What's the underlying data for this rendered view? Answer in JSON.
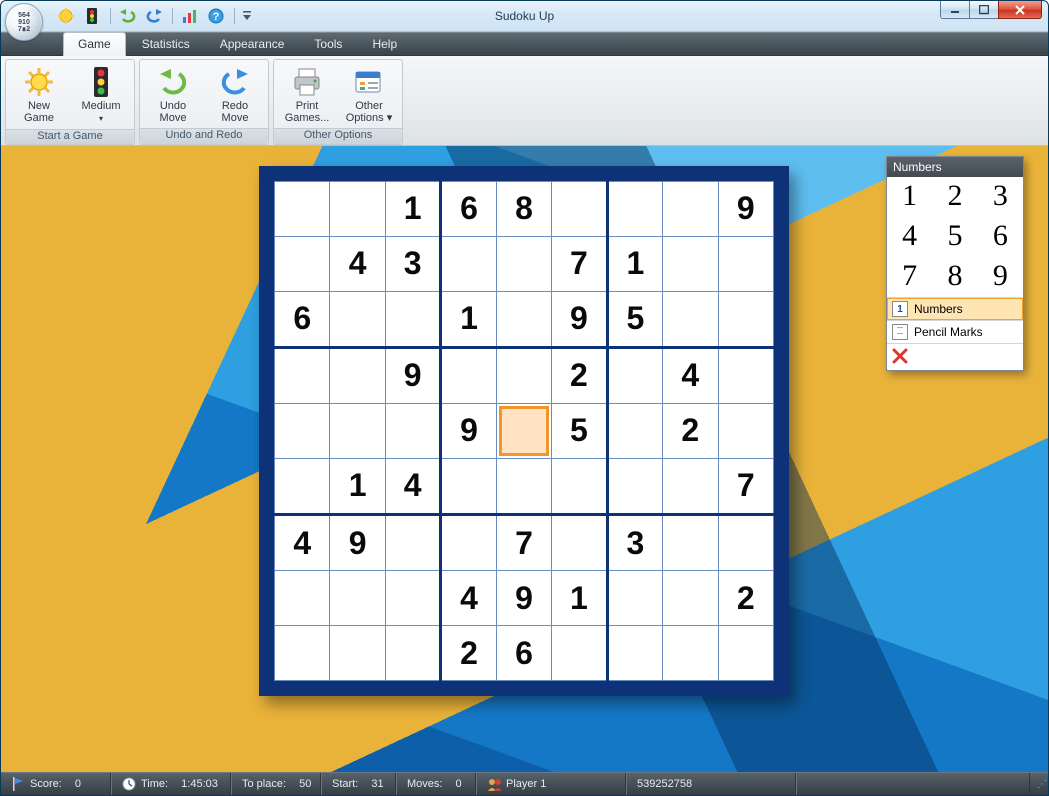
{
  "window": {
    "title": "Sudoku Up"
  },
  "qat": {
    "items": [
      "new-game",
      "difficulty",
      "sep",
      "undo",
      "redo",
      "sep",
      "stats",
      "help",
      "sep",
      "more"
    ]
  },
  "tabs": [
    "Game",
    "Statistics",
    "Appearance",
    "Tools",
    "Help"
  ],
  "active_tab": 0,
  "ribbon": {
    "groups": [
      {
        "label": "Start a Game",
        "buttons": [
          {
            "id": "new-game",
            "line1": "New",
            "line2": "Game"
          },
          {
            "id": "difficulty",
            "line1": "Medium",
            "line2": "▾"
          }
        ]
      },
      {
        "label": "Undo and Redo",
        "buttons": [
          {
            "id": "undo",
            "line1": "Undo",
            "line2": "Move"
          },
          {
            "id": "redo",
            "line1": "Redo",
            "line2": "Move"
          }
        ]
      },
      {
        "label": "Other Options",
        "buttons": [
          {
            "id": "print",
            "line1": "Print",
            "line2": "Games..."
          },
          {
            "id": "options",
            "line1": "Other",
            "line2": "Options ▾"
          }
        ]
      }
    ]
  },
  "board": {
    "selected": [
      4,
      4
    ],
    "cells": [
      [
        "",
        "",
        "1",
        "6",
        "8",
        "",
        "",
        "",
        "9"
      ],
      [
        "",
        "4",
        "3",
        "",
        "",
        "7",
        "1",
        "",
        ""
      ],
      [
        "6",
        "",
        "",
        "1",
        "",
        "9",
        "5",
        "",
        ""
      ],
      [
        "",
        "",
        "9",
        "",
        "",
        "2",
        "",
        "4",
        ""
      ],
      [
        "",
        "",
        "",
        "9",
        "",
        "5",
        "",
        "2",
        ""
      ],
      [
        "",
        "1",
        "4",
        "",
        "",
        "",
        "",
        "",
        "7"
      ],
      [
        "4",
        "9",
        "",
        "",
        "7",
        "",
        "3",
        "",
        ""
      ],
      [
        "",
        "",
        "",
        "4",
        "9",
        "1",
        "",
        "",
        "2"
      ],
      [
        "",
        "",
        "",
        "2",
        "6",
        "",
        "",
        "",
        ""
      ]
    ]
  },
  "numbers_panel": {
    "title": "Numbers",
    "digits": [
      "1",
      "2",
      "3",
      "4",
      "5",
      "6",
      "7",
      "8",
      "9"
    ],
    "mode_numbers": "Numbers",
    "mode_pencil": "Pencil Marks",
    "selected_mode": "numbers"
  },
  "status": {
    "score_label": "Score:",
    "score_value": "0",
    "time_label": "Time:",
    "time_value": "1:45:03",
    "toplace_label": "To place:",
    "toplace_value": "50",
    "start_label": "Start:",
    "start_value": "31",
    "moves_label": "Moves:",
    "moves_value": "0",
    "player_label": "Player 1",
    "game_id": "539252758"
  }
}
